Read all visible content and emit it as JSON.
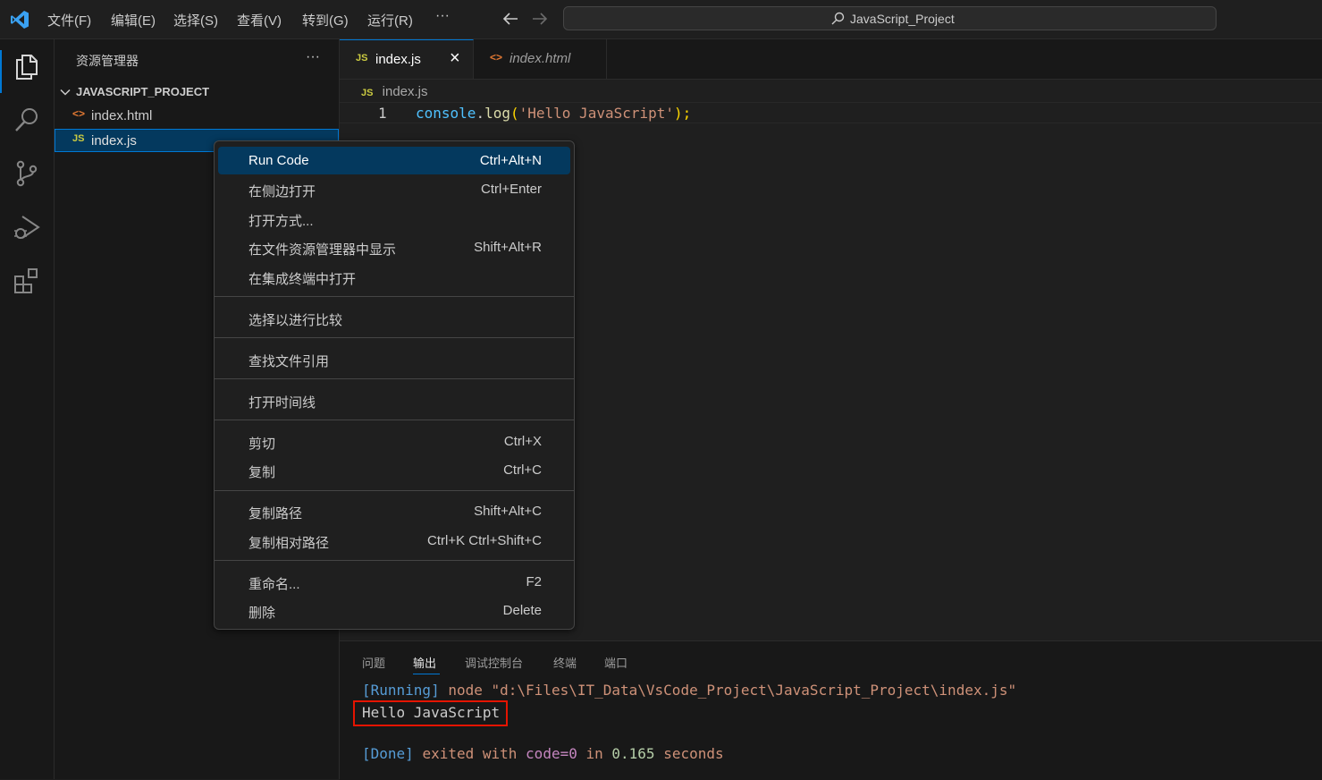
{
  "titlebar": {
    "menus": [
      "文件(F)",
      "编辑(E)",
      "选择(S)",
      "查看(V)",
      "转到(G)",
      "运行(R)",
      "···"
    ],
    "search_text": "JavaScript_Project"
  },
  "activitybar": {
    "icons": [
      "explorer-icon",
      "search-icon",
      "source-control-icon",
      "run-debug-icon",
      "extensions-icon"
    ]
  },
  "sidebar": {
    "title": "资源管理器",
    "more": "···",
    "project": "JAVASCRIPT_PROJECT",
    "files": [
      {
        "icon": "<>",
        "name": "index.html"
      },
      {
        "icon": "JS",
        "name": "index.js"
      }
    ]
  },
  "editor": {
    "tabs": [
      {
        "icon": "JS",
        "label": "index.js",
        "close": "×"
      },
      {
        "icon": "<>",
        "label": "index.html"
      }
    ],
    "breadcrumb": {
      "icon": "JS",
      "label": "index.js"
    },
    "line_number": "1",
    "code": {
      "obj": "console",
      "dot": ".",
      "fn": "log",
      "open": "(",
      "str": "'Hello JavaScript'",
      "close": ");"
    }
  },
  "context_menu": {
    "run_code": {
      "label": "Run Code",
      "key": "Ctrl+Alt+N"
    },
    "open_side": {
      "label": "在侧边打开",
      "key": "Ctrl+Enter"
    },
    "open_with": {
      "label": "打开方式..."
    },
    "reveal": {
      "label": "在文件资源管理器中显示",
      "key": "Shift+Alt+R"
    },
    "open_terminal": {
      "label": "在集成终端中打开"
    },
    "compare": {
      "label": "选择以进行比较"
    },
    "find_refs": {
      "label": "查找文件引用"
    },
    "timeline": {
      "label": "打开时间线"
    },
    "cut": {
      "label": "剪切",
      "key": "Ctrl+X"
    },
    "copy": {
      "label": "复制",
      "key": "Ctrl+C"
    },
    "copy_path": {
      "label": "复制路径",
      "key": "Shift+Alt+C"
    },
    "copy_rel_path": {
      "label": "复制相对路径",
      "key": "Ctrl+K Ctrl+Shift+C"
    },
    "rename": {
      "label": "重命名...",
      "key": "F2"
    },
    "delete": {
      "label": "删除",
      "key": "Delete"
    }
  },
  "panel": {
    "tabs": [
      "问题",
      "输出",
      "调试控制台",
      "终端",
      "端口"
    ],
    "active_tab": "输出",
    "output": {
      "running_tag": "[Running]",
      "running_cmd": "node",
      "running_path": "\"d:\\Files\\IT_Data\\VsCode_Project\\JavaScript_Project\\index.js\"",
      "result": "Hello JavaScript",
      "done_tag": "[Done]",
      "done_a": "exited with",
      "done_code": "code=0",
      "done_in": "in",
      "done_time": "0.165",
      "done_unit": "seconds"
    }
  },
  "colors": {
    "accent": "#0078d4",
    "menu_highlight": "#04395e",
    "js_icon": "#cbcb41",
    "html_icon": "#e37933",
    "highlight_box": "#e51400"
  }
}
